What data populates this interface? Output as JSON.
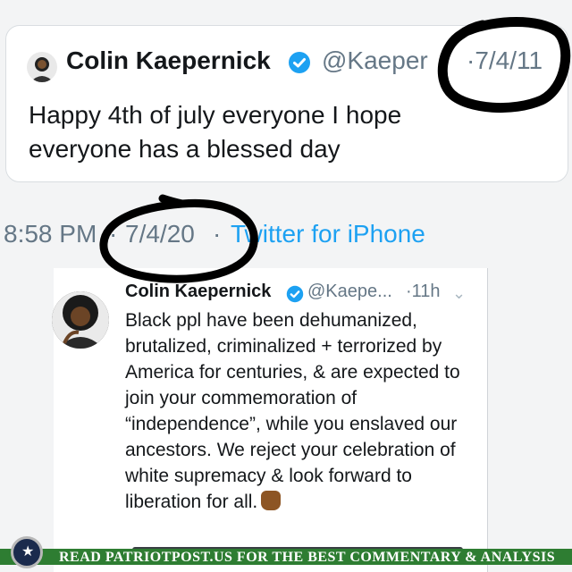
{
  "top_tweet": {
    "name": "Colin Kaepernick",
    "handle": "@Kaeper",
    "date": "·7/4/11",
    "text": "Happy 4th of july everyone I hope everyone has a blessed day"
  },
  "meta": {
    "time": "8:58 PM",
    "dot": "·",
    "date": "7/4/20",
    "source": "Twitter for iPhone"
  },
  "quoted_tweet": {
    "name": "Colin Kaepernick",
    "handle": "@Kaepe...",
    "time": "·11h",
    "chevron": "⌄",
    "text": "Black ppl have been dehumanized, brutalized, criminalized + terrorized by America for centuries, & are expected to join your commemoration of “independence”, while you enslaved our ancestors. We reject your celebration of white supremacy & look forward to liberation for all."
  },
  "footer": {
    "banner_text": "READ PATRIOTPOST.US FOR THE BEST COMMENTARY & ANALYSIS"
  },
  "colors": {
    "link": "#1da1f2",
    "verified": "#1da1f2",
    "muted": "#657786",
    "banner": "#2e7d32"
  },
  "icons": [
    "verified-badge-icon",
    "chevron-down-icon",
    "raised-fist-emoji",
    "star-seal-icon"
  ]
}
